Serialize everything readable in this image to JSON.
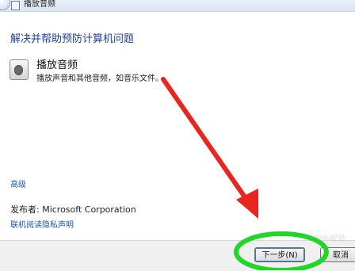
{
  "window": {
    "title": "播放音频"
  },
  "main": {
    "heading": "解决并帮助预防计算机问题",
    "item": {
      "icon": "speaker-icon",
      "title": "播放音频",
      "description": "播放声音和其他音频，如音乐文件。"
    },
    "advanced_link": "高级",
    "publisher": "发布者: Microsoft Corporation",
    "privacy_link": "联机阅读隐私声明"
  },
  "footer": {
    "next_label": "下一步(N)",
    "cancel_label": "取消"
  },
  "annotation": {
    "arrow_color": "#e8251e",
    "ellipse_color": "#22d628"
  },
  "watermark": "Baidu经验"
}
